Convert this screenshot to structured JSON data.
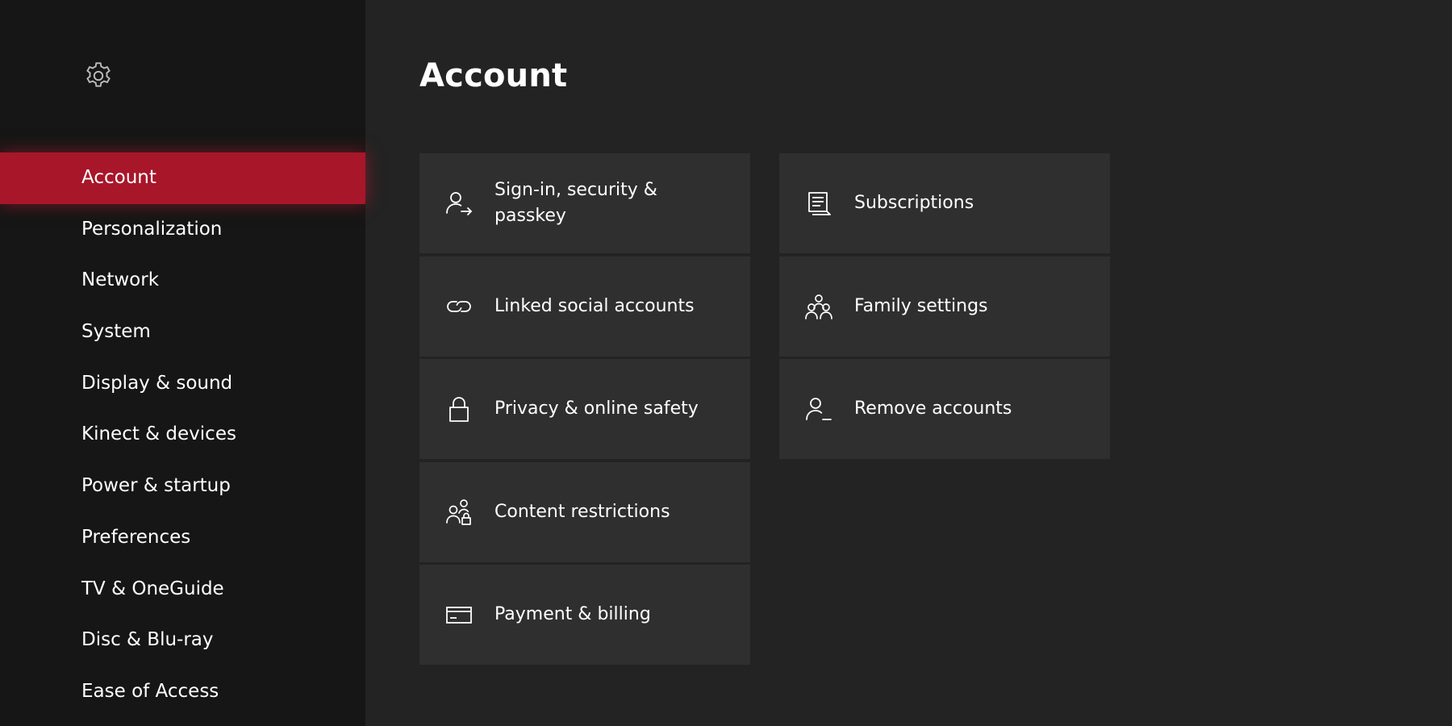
{
  "header": {
    "title": "Account",
    "settings_icon": "gear-icon"
  },
  "theme": {
    "accent": "#a8162a",
    "sidebar_bg": "#161616",
    "content_bg": "#232323",
    "tile_bg": "#2f2f2f",
    "text": "#ffffff"
  },
  "sidebar": {
    "items": [
      {
        "label": "Account",
        "active": true
      },
      {
        "label": "Personalization",
        "active": false
      },
      {
        "label": "Network",
        "active": false
      },
      {
        "label": "System",
        "active": false
      },
      {
        "label": "Display & sound",
        "active": false
      },
      {
        "label": "Kinect & devices",
        "active": false
      },
      {
        "label": "Power & startup",
        "active": false
      },
      {
        "label": "Preferences",
        "active": false
      },
      {
        "label": "TV & OneGuide",
        "active": false
      },
      {
        "label": "Disc & Blu-ray",
        "active": false
      },
      {
        "label": "Ease of Access",
        "active": false
      }
    ]
  },
  "tiles": {
    "left": [
      {
        "label": "Sign-in, security & passkey",
        "icon": "person-arrow-icon"
      },
      {
        "label": "Linked social accounts",
        "icon": "link-icon"
      },
      {
        "label": "Privacy & online safety",
        "icon": "lock-icon"
      },
      {
        "label": "Content restrictions",
        "icon": "people-lock-icon"
      },
      {
        "label": "Payment & billing",
        "icon": "credit-card-icon"
      }
    ],
    "right": [
      {
        "label": "Subscriptions",
        "icon": "subscription-list-icon"
      },
      {
        "label": "Family settings",
        "icon": "family-icon"
      },
      {
        "label": "Remove accounts",
        "icon": "person-remove-icon"
      }
    ]
  }
}
